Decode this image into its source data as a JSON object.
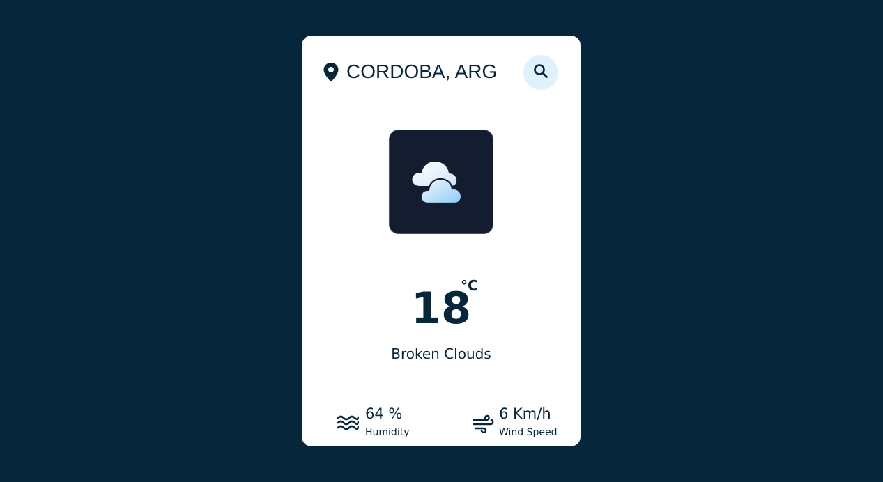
{
  "location": {
    "city": "CORDOBA, ARG",
    "icon": "map-pin-icon"
  },
  "search": {
    "icon": "search-icon"
  },
  "weather": {
    "icon": "cloud-icon",
    "temperature": "18",
    "unit": "°C",
    "condition": "Broken Clouds"
  },
  "stats": {
    "humidity": {
      "value": "64 %",
      "label": "Humidity",
      "icon": "humidity-waves-icon"
    },
    "wind": {
      "value": "6 Km/h",
      "label": "Wind Speed",
      "icon": "wind-icon"
    }
  },
  "colors": {
    "background": "#06263c",
    "card": "#ffffff",
    "text": "#06263c",
    "search_button_bg": "#dff2fb",
    "icon_tile_bg": "#141c30"
  }
}
